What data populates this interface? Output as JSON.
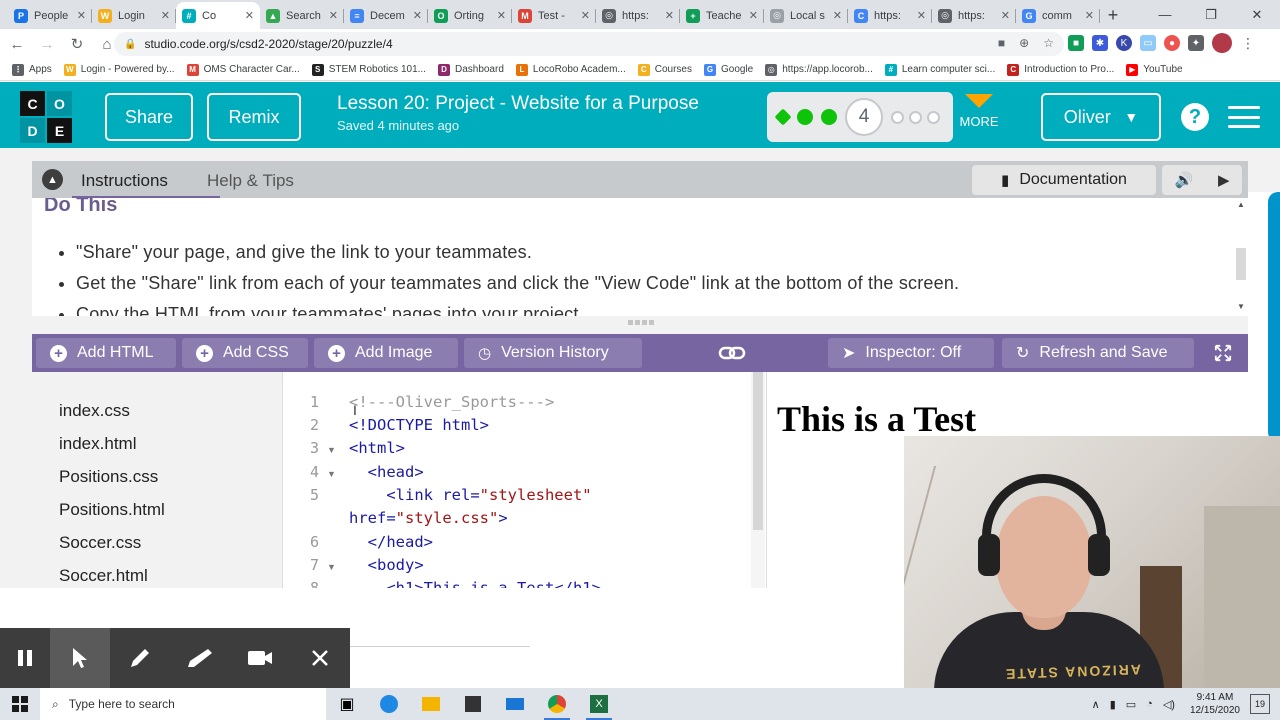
{
  "browser": {
    "tabs": [
      {
        "label": "People",
        "color": "#1a73e8",
        "glyph": "P"
      },
      {
        "label": "Login",
        "color": "#f2b01e",
        "glyph": "W"
      },
      {
        "label": "Co",
        "color": "#00adbc",
        "glyph": "#",
        "active": true
      },
      {
        "label": "Search",
        "color": "#34a853",
        "glyph": "▲"
      },
      {
        "label": "Decem",
        "color": "#4285f4",
        "glyph": "≡"
      },
      {
        "label": "Orting",
        "color": "#0f9d58",
        "glyph": "O"
      },
      {
        "label": "Test -",
        "color": "#db4437",
        "glyph": "M"
      },
      {
        "label": "https:",
        "color": "#5f6368",
        "glyph": "◎"
      },
      {
        "label": "Teache",
        "color": "#0f9d58",
        "glyph": "+"
      },
      {
        "label": "Local s",
        "color": "#9aa0a6",
        "glyph": "◎"
      },
      {
        "label": "https:",
        "color": "#4285f4",
        "glyph": "C"
      },
      {
        "label": "https:",
        "color": "#5f6368",
        "glyph": "◎"
      },
      {
        "label": "comm",
        "color": "#4285f4",
        "glyph": "G"
      }
    ],
    "url": "studio.code.org/s/csd2-2020/stage/20/puzzle/4",
    "bookmarks": [
      {
        "label": "Apps",
        "color": "#5f6368",
        "glyph": "⋮"
      },
      {
        "label": "Login - Powered by...",
        "color": "#f2b01e",
        "glyph": "W"
      },
      {
        "label": "OMS Character Car...",
        "color": "#db4437",
        "glyph": "M"
      },
      {
        "label": "STEM Robotics 101...",
        "color": "#222222",
        "glyph": "S"
      },
      {
        "label": "Dashboard",
        "color": "#8e2a6c",
        "glyph": "D"
      },
      {
        "label": "LocoRobo Academ...",
        "color": "#e8710a",
        "glyph": "L"
      },
      {
        "label": "Courses",
        "color": "#f2b01e",
        "glyph": "C"
      },
      {
        "label": "Google",
        "color": "#4285f4",
        "glyph": "G"
      },
      {
        "label": "https://app.locorob...",
        "color": "#5f6368",
        "glyph": "◎"
      },
      {
        "label": "Learn computer sci...",
        "color": "#00adbc",
        "glyph": "#"
      },
      {
        "label": "Introduction to Pro...",
        "color": "#c5221f",
        "glyph": "C"
      },
      {
        "label": "YouTube",
        "color": "#ff0000",
        "glyph": "▶"
      }
    ]
  },
  "header": {
    "logo_letters": [
      "C",
      "O",
      "D",
      "E"
    ],
    "share_label": "Share",
    "remix_label": "Remix",
    "lesson_title": "Lesson 20: Project - Website for a Purpose",
    "saved_text": "Saved 4 minutes ago",
    "current_level": "4",
    "more_label": "MORE",
    "user_name": "Oliver"
  },
  "instructions": {
    "tab_instructions": "Instructions",
    "tab_help": "Help & Tips",
    "documentation_label": "Documentation",
    "heading": "Do This",
    "bullets": [
      "\"Share\" your page, and give the link to your teammates.",
      "Get the \"Share\" link from each of your teammates and click the \"View Code\" link at the bottom of the screen.",
      "Copy the HTML from your teammates' pages into your project"
    ]
  },
  "toolbar": {
    "add_html": "Add HTML",
    "add_css": "Add CSS",
    "add_image": "Add Image",
    "version_history": "Version History",
    "inspector": "Inspector: Off",
    "refresh_save": "Refresh and Save"
  },
  "files": [
    "index.css",
    "index.html",
    "Positions.css",
    "Positions.html",
    "Soccer.css",
    "Soccer.html"
  ],
  "code": {
    "line_numbers": [
      "1",
      "2",
      "3",
      "4",
      "5",
      "",
      "6",
      "7",
      "8"
    ],
    "l1": "<!---Oliver_Sports--->",
    "l2": "<!DOCTYPE html>",
    "l3": "<html>",
    "l4": "  <head>",
    "l5a": "    <link rel=",
    "l5b": "\"stylesheet\"",
    "l5c": "href=",
    "l5d": "\"style.css\"",
    "l5e": ">",
    "l6": "  </head>",
    "l7": "  <body>",
    "l8": "    <h1>This is a Test</h1>"
  },
  "preview": {
    "h1": "This is a Test"
  },
  "webcam": {
    "shirt_text": "ARIZONA STATE"
  },
  "taskbar": {
    "search_placeholder": "Type here to search",
    "time": "9:41 AM",
    "date": "12/15/2020",
    "notification_count": "19"
  }
}
